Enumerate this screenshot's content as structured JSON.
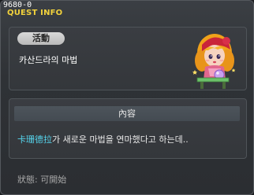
{
  "window": {
    "npc_id": "9680-0",
    "title": "QUEST INFO"
  },
  "quest": {
    "category_tag": "活動",
    "name": "카산드라의 마법"
  },
  "content": {
    "header": "內容",
    "npc_name": "卡珊德拉",
    "description_rest": "가 새로운 마법을 연마했다고 하는데.."
  },
  "status": {
    "text": "狀態:   可開始"
  },
  "colors": {
    "title": "#f2d23c",
    "npc_name": "#56d6ee"
  },
  "icons": {
    "npc_portrait": "fortune-teller-npc-icon"
  }
}
